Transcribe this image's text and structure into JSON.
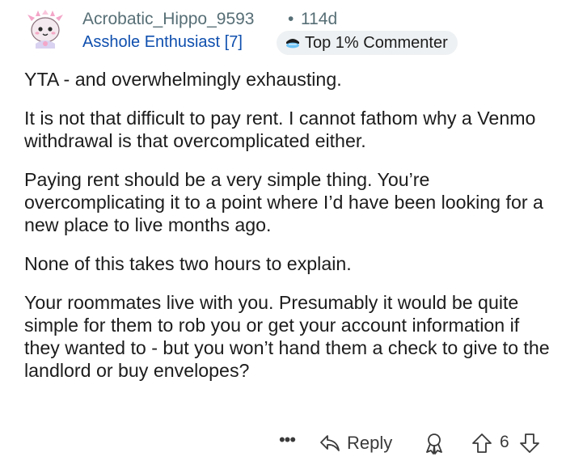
{
  "comment": {
    "author": "Acrobatic_Hippo_9593",
    "separator": "•",
    "age": "114d",
    "flair": "Asshole Enthusiast [7]",
    "badge_label": "Top 1% Commenter",
    "avatar_icon": "avatar-icon",
    "paragraphs": [
      "YTA - and overwhelmingly exhausting.",
      "It is not that difficult to pay rent.  I cannot fathom why a Venmo withdrawal  is that overcomplicated either.",
      "Paying rent should be a very simple thing. You’re overcomplicating it to a point where I’d have been looking for a new place to live months ago.",
      "None of this takes two hours to explain.",
      "Your roommates live with you.  Presumably it would be quite simple for them to rob you or get your account information if they wanted to - but you won’t hand them a check to give to the landlord or buy envelopes?"
    ],
    "actions": {
      "more_label": "•••",
      "reply_label": "Reply",
      "score": "6",
      "icons": [
        "more-icon",
        "reply-icon",
        "award-icon",
        "upvote-icon",
        "downvote-icon"
      ]
    },
    "colors": {
      "meta_gray": "#576f76",
      "flair_blue": "#0f4fae",
      "badge_bg": "#eef1f3",
      "text": "#1c1c1c"
    }
  }
}
